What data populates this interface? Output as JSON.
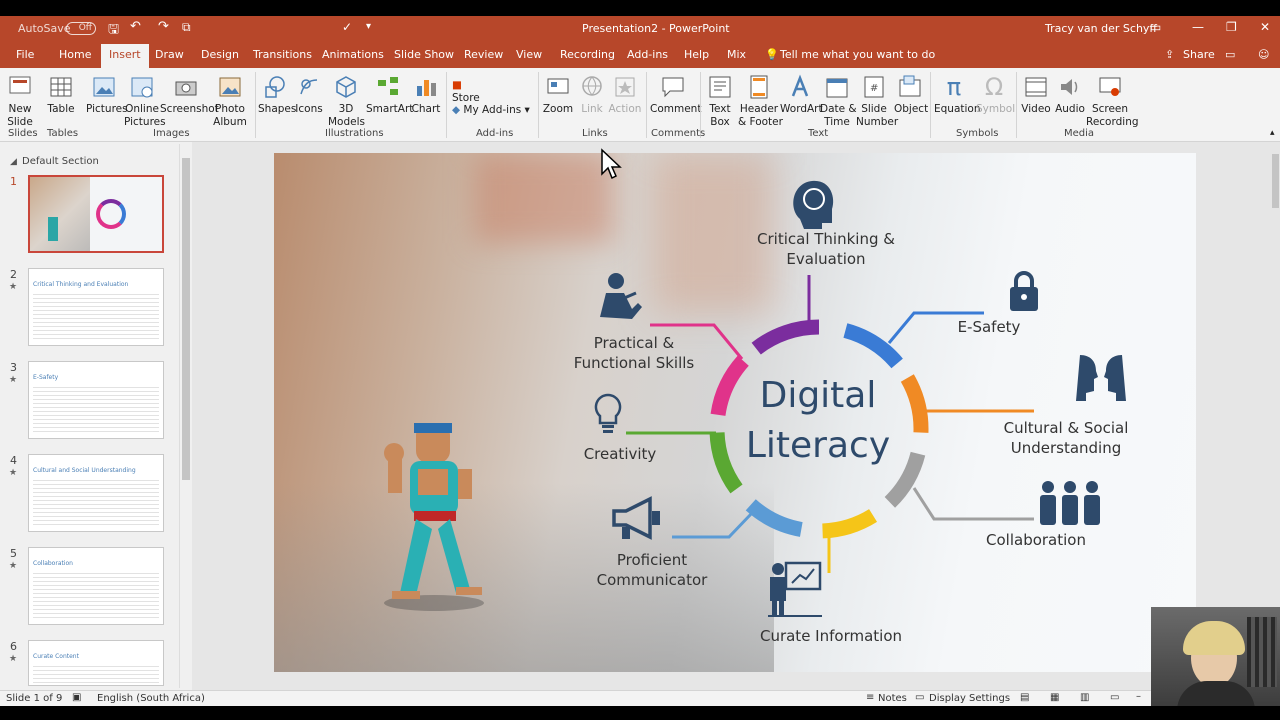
{
  "titlebar": {
    "autosave": "AutoSave",
    "autosave_state": "Off",
    "document_title": "Presentation2 - PowerPoint",
    "user": "Tracy van der Schyff"
  },
  "tabs": [
    "File",
    "Home",
    "Insert",
    "Draw",
    "Design",
    "Transitions",
    "Animations",
    "Slide Show",
    "Review",
    "View",
    "Recording",
    "Add-ins",
    "Help",
    "Mix"
  ],
  "active_tab": "Insert",
  "tell_me": "Tell me what you want to do",
  "share": "Share",
  "ribbon": {
    "new_slide": "New\nSlide",
    "table": "Table",
    "pictures": "Pictures",
    "online_pictures": "Online\nPictures",
    "screenshot": "Screenshot",
    "photo_album": "Photo\nAlbum",
    "shapes": "Shapes",
    "icons": "Icons",
    "models_3d": "3D\nModels",
    "smartart": "SmartArt",
    "chart": "Chart",
    "store": "Store",
    "my_addins": "My Add-ins",
    "zoom": "Zoom",
    "link": "Link",
    "action": "Action",
    "comment": "Comment",
    "text_box": "Text\nBox",
    "header_footer": "Header\n& Footer",
    "wordart": "WordArt",
    "date_time": "Date &\nTime",
    "slide_number": "Slide\nNumber",
    "object": "Object",
    "equation": "Equation",
    "symbol": "Symbol",
    "video": "Video",
    "audio": "Audio",
    "screen_recording": "Screen\nRecording",
    "groups": {
      "slides": "Slides",
      "tables": "Tables",
      "images": "Images",
      "illustrations": "Illustrations",
      "addins": "Add-ins",
      "links": "Links",
      "comments": "Comments",
      "text": "Text",
      "symbols": "Symbols",
      "media": "Media"
    }
  },
  "thumbnails": {
    "section": "Default Section",
    "slides": [
      {
        "num": "1",
        "title": ""
      },
      {
        "num": "2",
        "title": "Critical Thinking and Evaluation"
      },
      {
        "num": "3",
        "title": "E-Safety"
      },
      {
        "num": "4",
        "title": "Cultural and Social Understanding"
      },
      {
        "num": "5",
        "title": "Collaboration"
      },
      {
        "num": "6",
        "title": "Curate Content"
      }
    ]
  },
  "slide": {
    "center_line1": "Digital",
    "center_line2": "Literacy",
    "labels": {
      "critical": "Critical Thinking &\nEvaluation",
      "esafety": "E-Safety",
      "cultural": "Cultural & Social\nUnderstanding",
      "collaboration": "Collaboration",
      "curate": "Curate Information",
      "proficient": "Proficient\nCommunicator",
      "creativity": "Creativity",
      "practical": "Practical &\nFunctional Skills"
    },
    "colors": {
      "purple": "#7b2d9e",
      "blue": "#3a7bd5",
      "orange": "#f08a24",
      "gray": "#a0a0a0",
      "yellow": "#f5c518",
      "lightblue": "#5b9bd5",
      "green": "#5aa832",
      "pink": "#e0338a",
      "icon": "#2e4a6b"
    }
  },
  "statusbar": {
    "slide_of": "Slide 1 of 9",
    "language": "English (South Africa)",
    "notes": "Notes",
    "display_settings": "Display Settings"
  }
}
